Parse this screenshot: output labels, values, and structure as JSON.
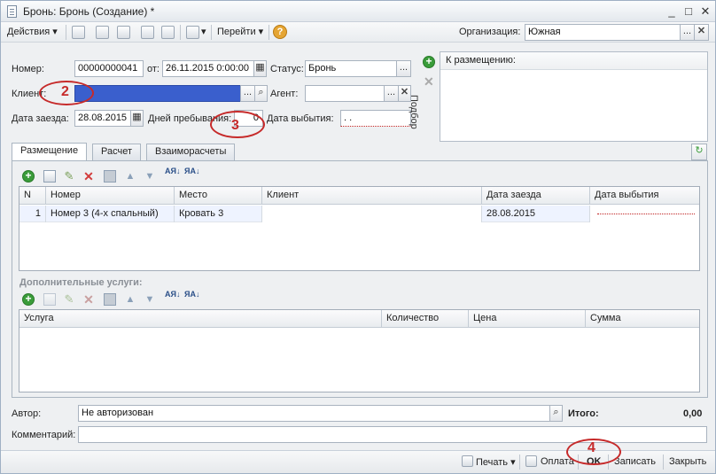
{
  "window": {
    "title": "Бронь: Бронь (Создание) *",
    "minimize": "_",
    "maximize": "□",
    "close": "✕"
  },
  "toolbar": {
    "actions_label": "Действия",
    "goto_label": "Перейти",
    "org_label": "Организация:",
    "org_value": "Южная",
    "help": "?"
  },
  "header": {
    "number_label": "Номер:",
    "number_value": "00000000041",
    "from_label": "от:",
    "date_value": "26.11.2015  0:00:00",
    "status_label": "Статус:",
    "status_value": "Бронь",
    "client_label": "Клиент:",
    "client_value": "",
    "agent_label": "Агент:",
    "agent_value": "",
    "arrival_label": "Дата заезда:",
    "arrival_value": "28.08.2015",
    "stay_label": "Дней пребывания:",
    "stay_value": "0",
    "departure_label": "Дата выбытия:",
    "departure_value": " .  .    "
  },
  "placement_panel": {
    "header": "К размещению:",
    "side_label": "Подбор"
  },
  "tabs": [
    {
      "label": "Размещение"
    },
    {
      "label": "Расчет"
    },
    {
      "label": "Взаиморасчеты"
    }
  ],
  "rooms_grid": {
    "columns": [
      "N",
      "Номер",
      "Место",
      "Клиент",
      "Дата заезда",
      "Дата выбытия"
    ],
    "rows": [
      {
        "n": "1",
        "room": "Номер 3 (4-х спальный)",
        "place": "Кровать 3",
        "client": "",
        "arrival": "28.08.2015",
        "departure": ""
      }
    ]
  },
  "services": {
    "label": "Дополнительные услуги:",
    "columns": [
      "Услуга",
      "Количество",
      "Цена",
      "Сумма"
    ]
  },
  "footer": {
    "author_label": "Автор:",
    "author_value": "Не авторизован",
    "total_label": "Итого:",
    "total_value": "0,00",
    "comment_label": "Комментарий:",
    "comment_value": "",
    "print_label": "Печать",
    "pay_label": "Оплата",
    "ok_label": "OK",
    "save_label": "Записать",
    "close_label": "Закрыть"
  },
  "annotations": [
    "2",
    "3",
    "4"
  ],
  "colors": {
    "selection_blue": "#3a5fcd",
    "annotation_red": "#c62a2a",
    "plus_green": "#3a9c3a"
  }
}
